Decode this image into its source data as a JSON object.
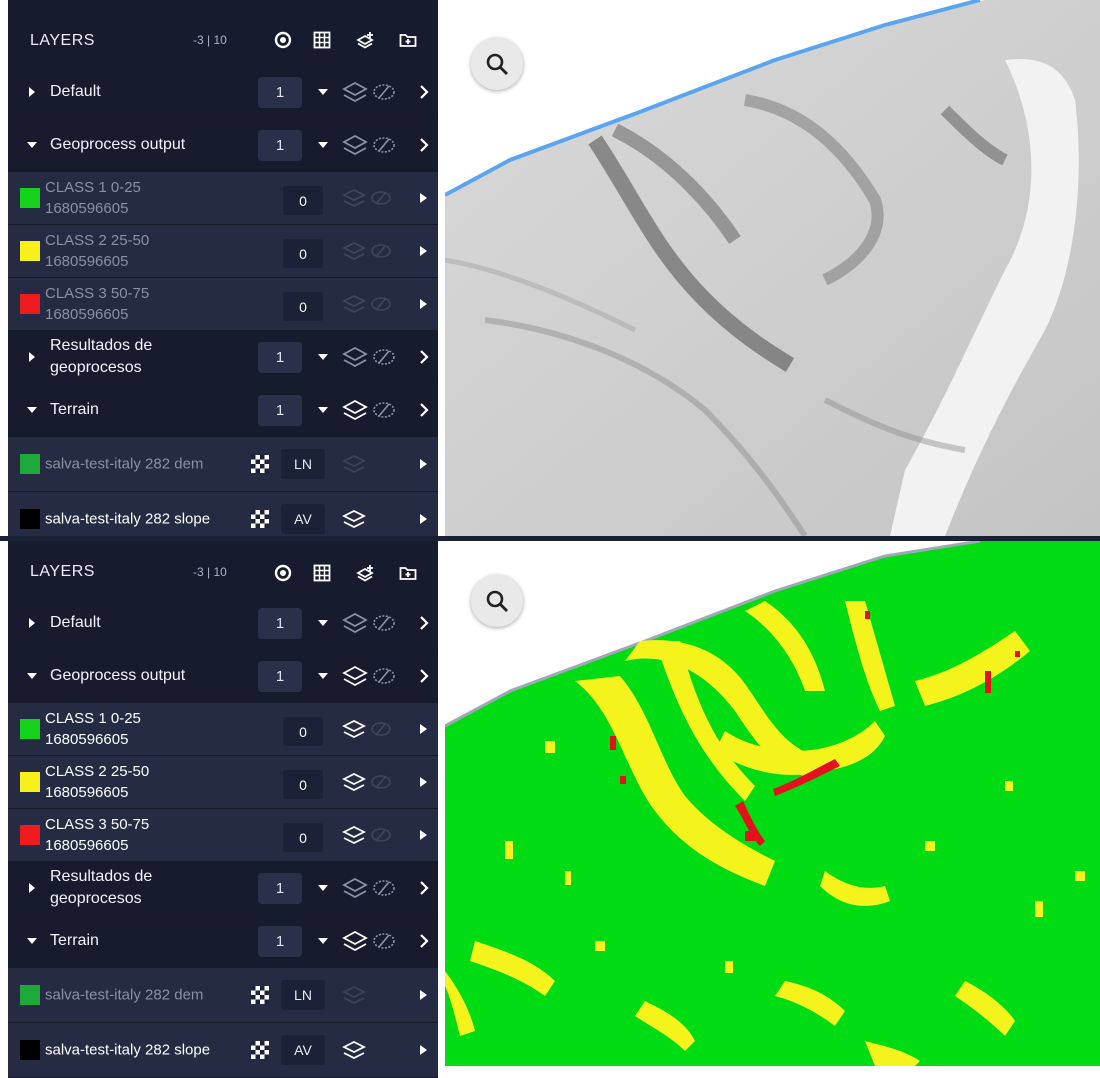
{
  "panels": [
    {
      "header": {
        "title": "LAYERS",
        "count": "-3 | 10"
      },
      "groups": [
        {
          "name": "Default",
          "count": "1"
        },
        {
          "name": "Geoprocess output",
          "count": "1"
        },
        {
          "name": "Resultados de geoprocesos",
          "count": "1"
        },
        {
          "name": "Terrain",
          "count": "1"
        }
      ],
      "layers": [
        {
          "name": "CLASS 1 0-25",
          "sub": "1680596605",
          "value": "0",
          "color": "#16d21d"
        },
        {
          "name": "CLASS 2 25-50",
          "sub": "1680596605",
          "value": "0",
          "color": "#f7f01a"
        },
        {
          "name": "CLASS 3 50-75",
          "sub": "1680596605",
          "value": "0",
          "color": "#ee1b1f"
        }
      ],
      "terrain": [
        {
          "name": "salva-test-italy 282 dem",
          "mode": "LN",
          "color": "#1fa83a"
        },
        {
          "name": "salva-test-italy 282 slope",
          "mode": "AV",
          "color": "#000000"
        }
      ]
    },
    {
      "header": {
        "title": "LAYERS",
        "count": "-3 | 10"
      },
      "groups": [
        {
          "name": "Default",
          "count": "1"
        },
        {
          "name": "Geoprocess output",
          "count": "1"
        },
        {
          "name": "Resultados de geoprocesos",
          "count": "1"
        },
        {
          "name": "Terrain",
          "count": "1"
        }
      ],
      "layers": [
        {
          "name": "CLASS 1 0-25",
          "sub": "1680596605",
          "value": "0",
          "color": "#16d21d"
        },
        {
          "name": "CLASS 2 25-50",
          "sub": "1680596605",
          "value": "0",
          "color": "#f7f01a"
        },
        {
          "name": "CLASS 3 50-75",
          "sub": "1680596605",
          "value": "0",
          "color": "#ee1b1f"
        }
      ],
      "terrain": [
        {
          "name": "salva-test-italy 282 dem",
          "mode": "LN",
          "color": "#1fa83a"
        },
        {
          "name": "salva-test-italy 282 slope",
          "mode": "AV",
          "color": "#000000"
        }
      ]
    }
  ],
  "colors": {
    "sidebar_bg": "#1c2237",
    "header_bg": "#161b2e",
    "slope_green": "#00dc14",
    "slope_yellow": "#f4f41c",
    "slope_red": "#e4101c",
    "boundary_blue": "#5aa5ee"
  },
  "icons": [
    "target-icon",
    "grid-icon",
    "layers-plus-icon",
    "folder-plus-icon",
    "search-icon",
    "caret-right-icon",
    "caret-down-icon",
    "dropdown-icon",
    "stack-icon",
    "eye-off-icon",
    "chevron-right-icon",
    "checker-icon"
  ]
}
